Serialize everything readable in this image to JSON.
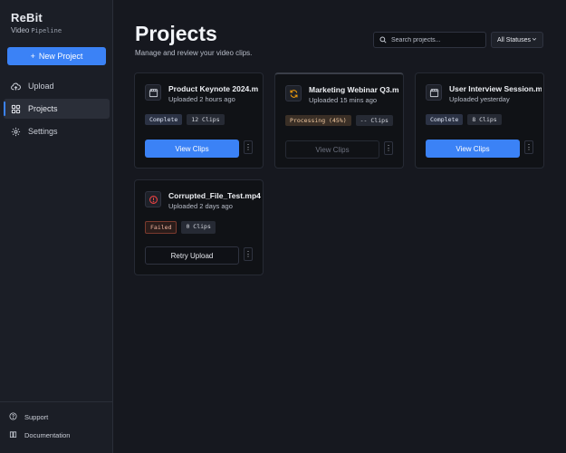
{
  "brand": {
    "name": "ReBit",
    "sub": "Video",
    "sub_mono": "Pipeline"
  },
  "sidebar": {
    "new_project_label": "New Project",
    "nav": [
      {
        "label": "Upload",
        "icon": "cloud-upload-icon"
      },
      {
        "label": "Projects",
        "icon": "grid-icon",
        "active": true
      },
      {
        "label": "Settings",
        "icon": "gear-icon"
      }
    ],
    "footer": [
      {
        "label": "Support",
        "icon": "help-circle-icon"
      },
      {
        "label": "Documentation",
        "icon": "book-icon"
      }
    ]
  },
  "header": {
    "title": "Projects",
    "subtitle": "Manage and review your video clips.",
    "search_placeholder": "Search projects...",
    "status_filter": "All Statuses"
  },
  "projects": [
    {
      "title": "Product Keynote 2024.m",
      "meta": "Uploaded 2 hours ago",
      "status": "Complete",
      "clips": "12 Clips",
      "action": "View Clips",
      "icon": "clapperboard-icon"
    },
    {
      "title": "Marketing Webinar Q3.m",
      "meta": "Uploaded 15 mins ago",
      "status": "Processing (45%)",
      "clips": "-- Clips",
      "action": "View Clips",
      "icon": "sync-icon"
    },
    {
      "title": "User Interview Session.m",
      "meta": "Uploaded yesterday",
      "status": "Complete",
      "clips": "8 Clips",
      "action": "View Clips",
      "icon": "clapperboard-icon"
    },
    {
      "title": "Corrupted_File_Test.mp4",
      "meta": "Uploaded 2 days ago",
      "status": "Failed",
      "clips": "0 Clips",
      "action": "Retry Upload",
      "icon": "alert-circle-icon"
    }
  ],
  "colors": {
    "accent": "#3b82f6",
    "warning": "#f59e0b",
    "error": "#ef4444",
    "background": "#16181f",
    "sidebar": "#1b1e26"
  }
}
